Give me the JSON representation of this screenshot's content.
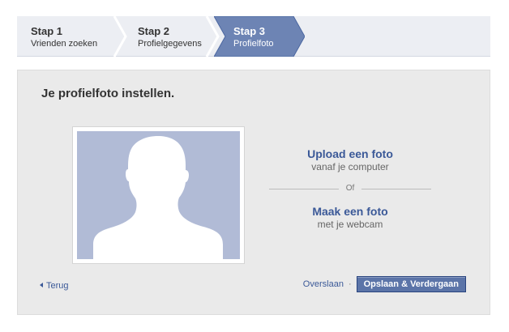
{
  "steps": [
    {
      "title": "Stap 1",
      "subtitle": "Vrienden zoeken"
    },
    {
      "title": "Stap 2",
      "subtitle": "Profielgegevens"
    },
    {
      "title": "Stap 3",
      "subtitle": "Profielfoto"
    }
  ],
  "panel": {
    "title": "Je profielfoto instellen.",
    "upload": {
      "label": "Upload een foto",
      "sub": "vanaf je computer"
    },
    "or_label": "Of",
    "webcam": {
      "label": "Maak een foto",
      "sub": "met je webcam"
    },
    "back_label": "Terug",
    "skip_label": "Overslaan",
    "separator": "·",
    "save_label": "Opslaan & Verdergaan"
  },
  "colors": {
    "brand": "#3b5998",
    "active_step": "#6d84b4",
    "button": "#5b74a8",
    "placeholder": "#b1bbd6"
  }
}
